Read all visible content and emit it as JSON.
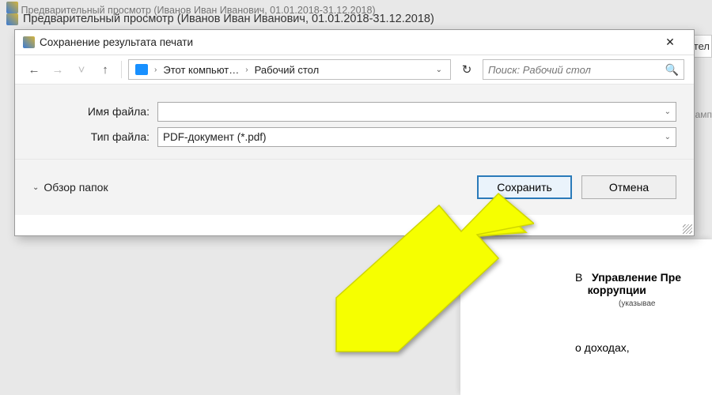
{
  "background": {
    "title1": "Предварительный просмотр (Иванов Иван Иванович, 01.01.2018-31.12.2018)",
    "title2": "Предварительный просмотр (Иванов Иван Иванович, 01.01.2018-31.12.2018)",
    "tab1": "нител",
    "tab2": "й камп"
  },
  "document": {
    "prefix": "В",
    "heading1": "Управление Пре",
    "heading2": "коррупции",
    "note": "(указывае",
    "sub": "о доходах,"
  },
  "dialog": {
    "title": "Сохранение результата печати",
    "path": {
      "seg1": "Этот компьют…",
      "seg2": "Рабочий стол"
    },
    "search_placeholder": "Поиск: Рабочий стол",
    "fields": {
      "name_label": "Имя файла:",
      "name_value": "",
      "type_label": "Тип файла:",
      "type_value": "PDF-документ (*.pdf)"
    },
    "browse_folders": "Обзор папок",
    "buttons": {
      "save": "Сохранить",
      "cancel": "Отмена"
    }
  }
}
